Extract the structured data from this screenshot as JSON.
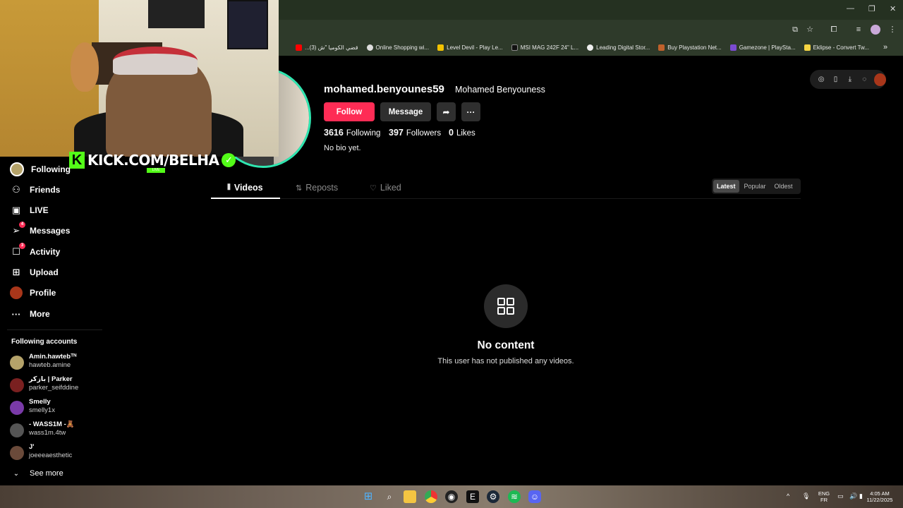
{
  "browser": {
    "bookmarks": [
      {
        "label": "...قضي الكوميا \"ش (3)",
        "color": "#ff0000"
      },
      {
        "label": "Online Shopping wi...",
        "color": "#dddddd"
      },
      {
        "label": "Level Devil - Play Le...",
        "color": "#f2c200"
      },
      {
        "label": "MSI MAG 242F 24\" L...",
        "color": "#222222"
      },
      {
        "label": "Leading Digital Stor...",
        "color": "#eeeeee"
      },
      {
        "label": "Buy Playstation Net...",
        "color": "#c0612b"
      },
      {
        "label": "Gamezone | PlaySta...",
        "color": "#7a4bd1"
      },
      {
        "label": "Eklipse - Convert Tw...",
        "color": "#f5d442"
      }
    ],
    "more_bookmarks": "»"
  },
  "overlay": {
    "kick_text": "KICK.COM/BELHA",
    "kick_k": "K",
    "kick_live": "LIVE"
  },
  "sidebar": {
    "items": [
      {
        "label": "Following",
        "icon": "following-avatar-icon",
        "glyph": ""
      },
      {
        "label": "Friends",
        "icon": "friends-icon",
        "glyph": "👥"
      },
      {
        "label": "LIVE",
        "icon": "live-icon",
        "glyph": "▭"
      },
      {
        "label": "Messages",
        "icon": "messages-icon",
        "glyph": "✈",
        "badge": "4"
      },
      {
        "label": "Activity",
        "icon": "activity-icon",
        "glyph": "▢",
        "badge": "3"
      },
      {
        "label": "Upload",
        "icon": "upload-icon",
        "glyph": "⊞"
      },
      {
        "label": "Profile",
        "icon": "profile-avatar-icon",
        "glyph": ""
      },
      {
        "label": "More",
        "icon": "more-dots-icon",
        "glyph": "···"
      }
    ],
    "following_title": "Following accounts",
    "accounts": [
      {
        "name": "Amin.hawtebᵀᴺ",
        "handle": "hawteb.amine",
        "color": "#b5a36a"
      },
      {
        "name": "بازكر | Parker",
        "handle": "parker_seifddine",
        "color": "#7a2020"
      },
      {
        "name": "Smelly",
        "handle": "smelly1x",
        "color": "#7a3aa8"
      },
      {
        "name": "- WASS1M -🧸",
        "handle": "wass1m.4tw",
        "color": "#555555"
      },
      {
        "name": "J'",
        "handle": "joeeeaesthetic",
        "color": "#6a4a3a"
      }
    ],
    "see_more": "See more"
  },
  "profile": {
    "username": "mohamed.benyounes59",
    "display_name": "Mohamed Benyouness",
    "follow_label": "Follow",
    "message_label": "Message",
    "following_count": "3616",
    "following_label": "Following",
    "followers_count": "397",
    "followers_label": "Followers",
    "likes_count": "0",
    "likes_label": "Likes",
    "bio": "No bio yet."
  },
  "tabs": [
    {
      "label": "Videos",
      "icon": "grid-icon",
      "glyph": "⦀"
    },
    {
      "label": "Reposts",
      "icon": "repost-icon",
      "glyph": "⇅"
    },
    {
      "label": "Liked",
      "icon": "liked-heart-icon",
      "glyph": "♡"
    }
  ],
  "sort": [
    "Latest",
    "Popular",
    "Oldest"
  ],
  "empty": {
    "title": "No content",
    "subtitle": "This user has not published any videos."
  },
  "taskbar": {
    "lang_top": "ENG",
    "lang_bottom": "FR",
    "time": "4:05 AM",
    "date": "11/22/2025"
  },
  "colors": {
    "accent": "#fe2c55",
    "kick_green": "#53fc18"
  }
}
